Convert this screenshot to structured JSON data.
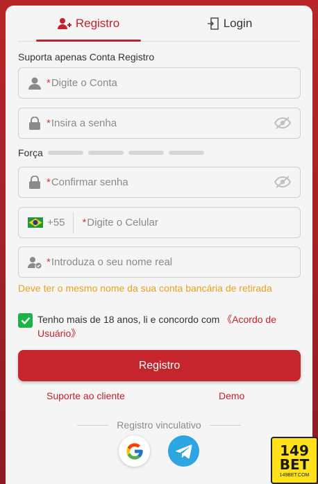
{
  "tabs": {
    "registro": "Registro",
    "login": "Login"
  },
  "form": {
    "support_note": "Suporta apenas Conta Registro",
    "account": {
      "required": "*",
      "placeholder": "Digite o Conta"
    },
    "password": {
      "required": "*",
      "placeholder": "Insira a senha"
    },
    "strength_label": "Força",
    "confirm": {
      "required": "*",
      "placeholder": "Confirmar senha"
    },
    "phone": {
      "country_code": "+55",
      "required": "*",
      "placeholder": "Digite o Celular"
    },
    "realname": {
      "required": "*",
      "placeholder": "Introduza o seu nome real"
    },
    "realname_hint": "Deve ter o mesmo nome da sua conta bancária de retirada"
  },
  "agreement": {
    "text": "Tenho mais de 18 anos, li e concordo com ",
    "link": "《Acordo de Usuário》",
    "checked": true
  },
  "submit_label": "Registro",
  "links": {
    "support": "Suporte ao cliente",
    "demo": "Demo"
  },
  "divider_text": "Registro vinculativo",
  "badge": {
    "line1": "149",
    "line2": "BET",
    "line3": "149BET.COM"
  },
  "colors": {
    "accent": "#c8202a",
    "hint": "#e9a21c",
    "check": "#1db34a",
    "telegram": "#2ca5e0"
  }
}
